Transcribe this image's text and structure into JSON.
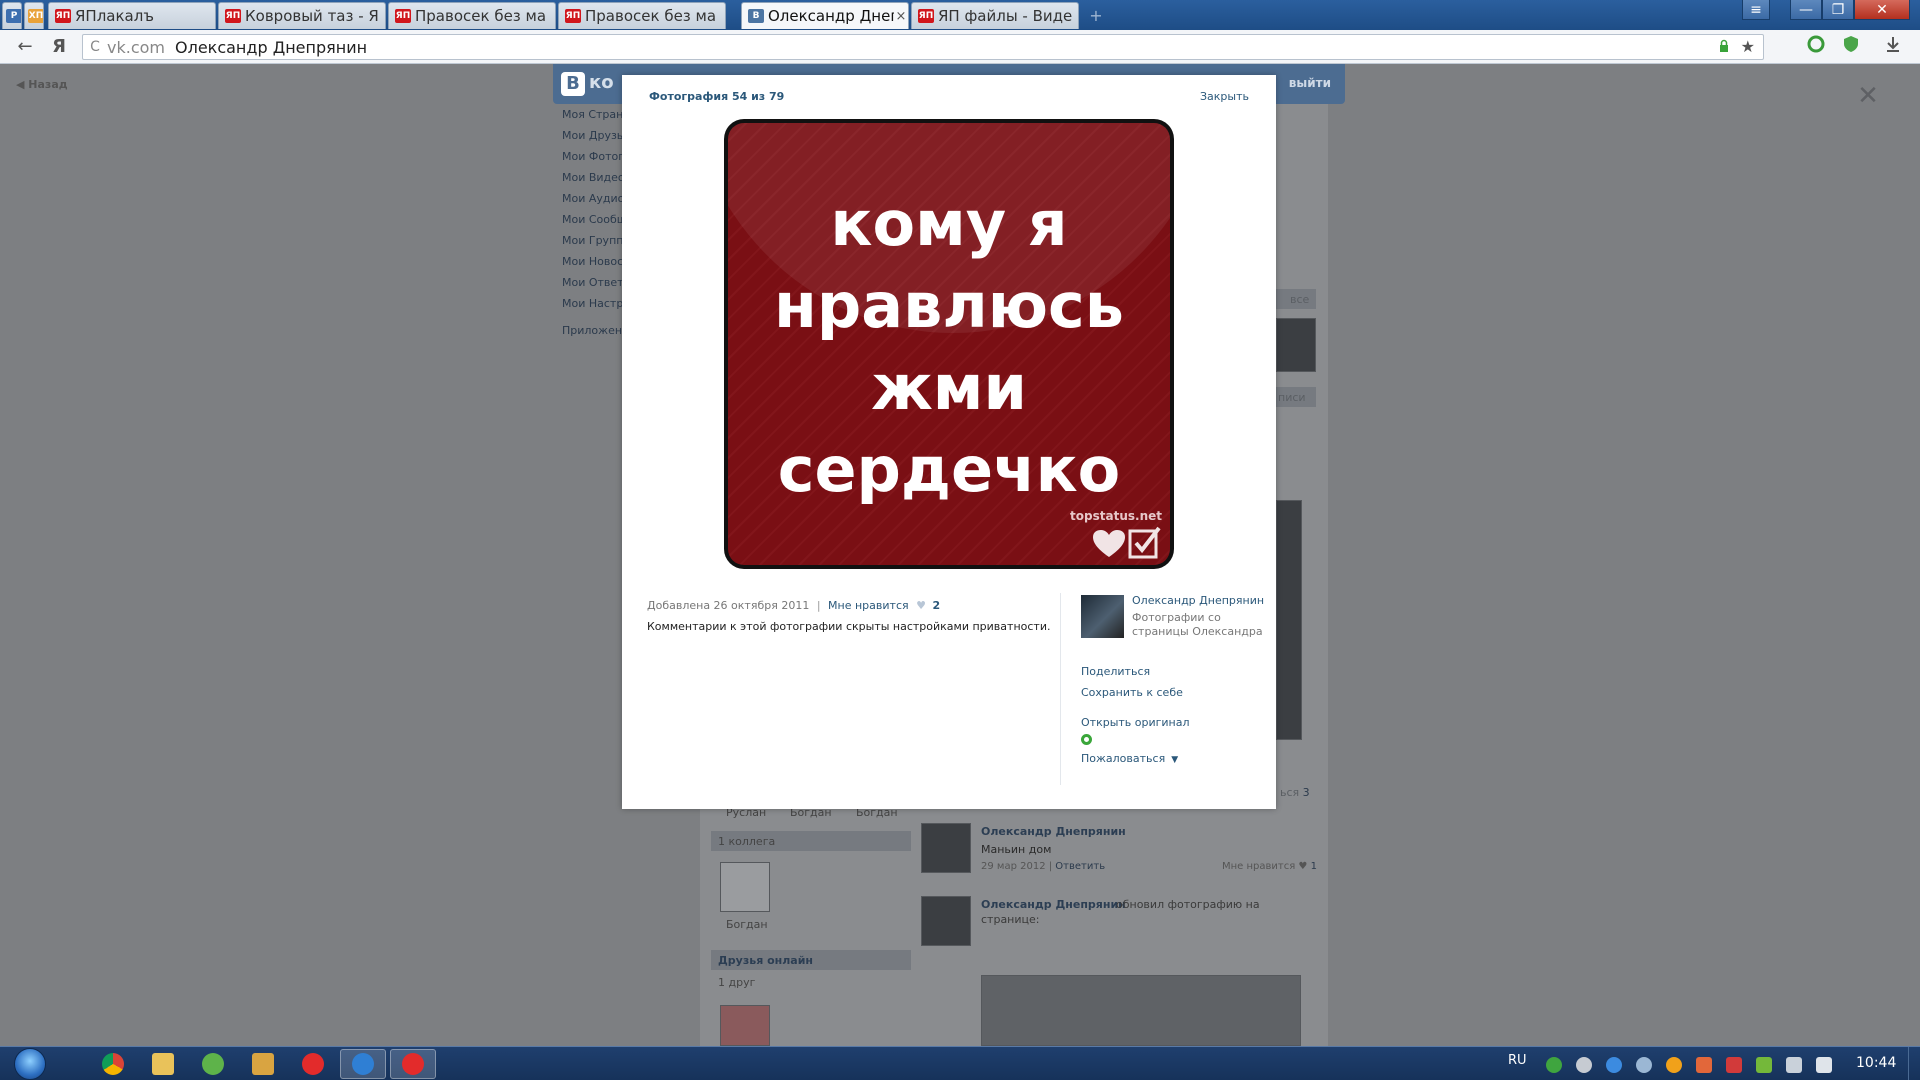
{
  "browser": {
    "tabs": [
      {
        "label": "",
        "favicon": "P",
        "favicon_color": "#3d6fb0"
      },
      {
        "label": "",
        "favicon": "ХП",
        "favicon_color": "#e8a23a"
      },
      {
        "label": "ЯПлакалъ",
        "favicon": "ЯП",
        "favicon_color": "#d1161c"
      },
      {
        "label": "Ковровый таз - Я",
        "favicon": "ЯП",
        "favicon_color": "#d1161c"
      },
      {
        "label": "Правосек без ма",
        "favicon": "ЯП",
        "favicon_color": "#d1161c"
      },
      {
        "label": "Правосек без ма",
        "favicon": "ЯП",
        "favicon_color": "#d1161c"
      },
      {
        "label": "Олександр Днепр",
        "favicon": "B",
        "favicon_color": "#4c75a3",
        "active": true,
        "close": "×"
      },
      {
        "label": "ЯП файлы - Виде",
        "favicon": "ЯП",
        "favicon_color": "#d1161c"
      }
    ],
    "new_tab": "+",
    "window_controls": {
      "menu": "≡",
      "minimize": "—",
      "maximize": "❐",
      "close": "✕"
    },
    "nav": {
      "back": "←",
      "yandex": "Я"
    },
    "address": {
      "domain": "vk.com",
      "page_title": "Олександр Днепрянин",
      "reload": "C",
      "star": "★"
    }
  },
  "page": {
    "back_label": "Назад",
    "vk_logo": "B",
    "vk_logo_text": "ко",
    "logout": "выйти",
    "left_menu": [
      "Моя Страни",
      "Мои Друзья",
      "Мои Фотогр",
      "Мои Видеоз",
      "Мои Аудиоз",
      "Мои Сообщ",
      "Мои Группы",
      "Мои Новост",
      "Мои Ответы",
      "Мои Настро"
    ],
    "apps": "Приложени",
    "all_link": "все",
    "friends_names": [
      "Руслан",
      "Богдан",
      "Богдан"
    ],
    "colleagues_header": "1 коллега",
    "colleague_name": "Богдан",
    "friends_online_header": "Друзья онлайн",
    "friends_online_count": "1 друг",
    "wall": [
      {
        "author": "Олександр Днепрянин",
        "text": "Маньин дом",
        "date": "29 мар 2012",
        "reply": "Ответить",
        "likes_label": "Мне нравится",
        "likes_count": "1"
      },
      {
        "author": "Олександр Днепрянин",
        "text": "обновил фотографию на",
        "text2": "странице:"
      }
    ],
    "side_fragments": {
      "like_count_top": "3",
      "record_text": "писи",
      "likes_top_label": "ься"
    },
    "overlay_close": "✕"
  },
  "viewer": {
    "counter": "Фотография 54 из 79",
    "close_label": "Закрыть",
    "photo": {
      "lines": [
        "кому я",
        "нравлюсь",
        "жми",
        "сердечко"
      ],
      "watermark": "topstatus.net",
      "bg_color": "#7a0f14"
    },
    "added": "Добавлена 26 октября 2011",
    "like_label": "Мне нравится",
    "like_count": "2",
    "comments_hidden": "Комментарии к этой фотографии скрыты настройками приватности.",
    "author": "Олександр Днепрянин",
    "album_line1": "Фотографии со",
    "album_line2": "страницы Олександра",
    "share": "Поделиться",
    "save": "Сохранить к себе",
    "open_original": "Открыть оригинал",
    "report": "Пожаловаться"
  },
  "taskbar": {
    "apps": [
      "chrome-icon",
      "explorer-icon",
      "utorrent-icon",
      "media-player-icon",
      "yandex-icon",
      "browser-icon",
      "yandex-browser-icon"
    ],
    "lang": "RU",
    "time": "10:44"
  }
}
